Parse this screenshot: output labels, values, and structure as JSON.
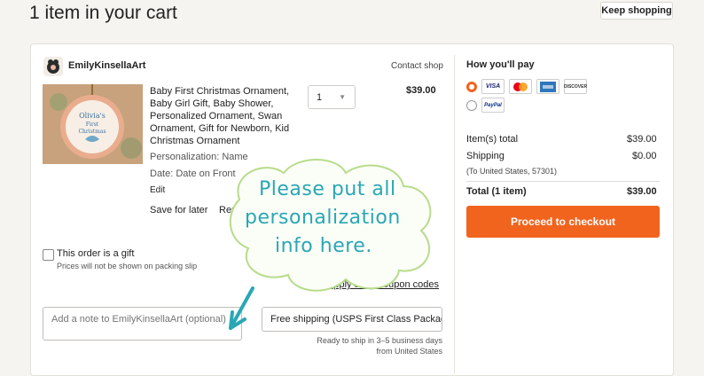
{
  "page": {
    "title": "1 item in your cart",
    "keep_shopping": "Keep shopping"
  },
  "shop": {
    "name": "EmilyKinsellaArt",
    "contact": "Contact shop"
  },
  "item": {
    "title": "Baby First Christmas Ornament, Baby Girl Gift, Baby Shower, Personalized Ornament, Swan Ornament, Gift for Newborn, Kid Christmas Ornament",
    "personalization": "Personalization: Name",
    "date": "Date: Date on Front",
    "edit": "Edit",
    "save_for_later": "Save for later",
    "remove": "Remove",
    "quantity": "1",
    "price": "$39.00",
    "thumb_text": "Olivia's First Christmas"
  },
  "gift": {
    "label": "This order is a gift",
    "note": "Prices will not be shown on packing slip"
  },
  "coupon": {
    "label": "Apply shop coupon codes"
  },
  "note": {
    "placeholder": "Add a note to EmilyKinsellaArt (optional)"
  },
  "shipping": {
    "selected": "Free shipping (USPS First Class Package)",
    "ready_line1": "Ready to ship in 3–5 business days",
    "ready_line2": "from United States"
  },
  "payment": {
    "title": "How you'll pay",
    "cards": [
      "VISA",
      "MasterCard",
      "Amex",
      "DISCOVER"
    ],
    "paypal": "PayPal",
    "selected": "cards"
  },
  "summary": {
    "items_total_label": "Item(s) total",
    "items_total": "$39.00",
    "shipping_label": "Shipping",
    "shipping": "$0.00",
    "to": "(To United States, 57301)",
    "total_label": "Total (1 item)",
    "total": "$39.00",
    "checkout": "Proceed to checkout"
  },
  "annotation": {
    "line1": "Please put all",
    "line2": "personalization",
    "line3": "info here."
  },
  "colors": {
    "accent": "#f1641e",
    "annotation": "#2aa7b4"
  }
}
